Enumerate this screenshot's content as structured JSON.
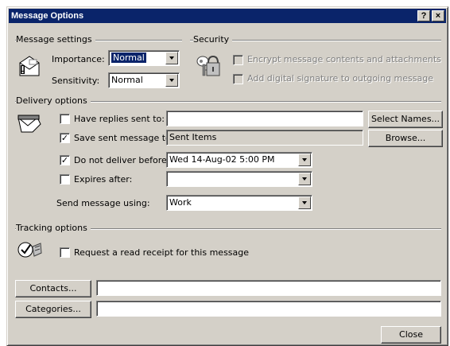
{
  "window": {
    "title": "Message Options",
    "help_glyph": "?",
    "close_glyph": "×"
  },
  "message_settings": {
    "group_label": "Message settings",
    "importance_label": "Importance:",
    "importance_value": "Normal",
    "sensitivity_label": "Sensitivity:",
    "sensitivity_value": "Normal"
  },
  "security": {
    "group_label": "Security",
    "encrypt_label": "Encrypt message contents and attachments",
    "signature_label": "Add digital signature to outgoing message"
  },
  "delivery": {
    "group_label": "Delivery options",
    "replies_label": "Have replies sent to:",
    "replies_value": "",
    "replies_checked": false,
    "select_names_label": "Select Names...",
    "save_sent_label": "Save sent message to:",
    "save_sent_value": "Sent Items",
    "save_sent_checked": true,
    "browse_label": "Browse...",
    "do_not_deliver_label": "Do not deliver before:",
    "do_not_deliver_value": "Wed 14-Aug-02 5:00 PM",
    "do_not_deliver_checked": true,
    "expires_label": "Expires after:",
    "expires_value": "",
    "expires_checked": false,
    "send_using_label": "Send message using:",
    "send_using_value": "Work"
  },
  "tracking": {
    "group_label": "Tracking options",
    "read_receipt_label": "Request a read receipt for this message",
    "read_receipt_checked": false
  },
  "footer": {
    "contacts_label": "Contacts...",
    "contacts_value": "",
    "categories_label": "Categories...",
    "categories_value": "",
    "close_label": "Close"
  },
  "check_glyph": "✓",
  "colors": {
    "titlebar": "#0a246a",
    "dialog": "#d4d0c8",
    "selection": "#0a246a"
  }
}
